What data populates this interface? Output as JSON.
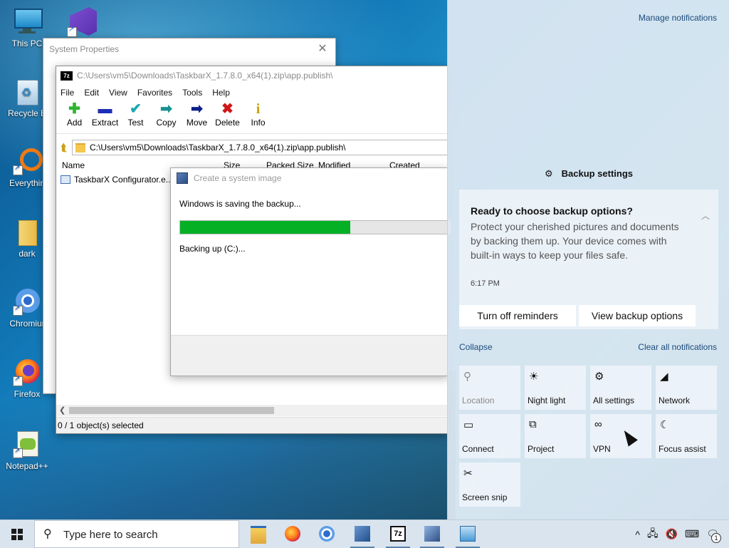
{
  "desktop": {
    "icons": [
      {
        "label": "This PC",
        "icon": "this-pc-icon"
      },
      {
        "label": "Recycle B",
        "icon": "recycle-bin-icon"
      },
      {
        "label": "Everythin",
        "icon": "everything-icon"
      },
      {
        "label": "dark",
        "icon": "folder-icon"
      },
      {
        "label": "Chromiur",
        "icon": "chromium-icon"
      },
      {
        "label": "Firefox",
        "icon": "firefox-icon"
      },
      {
        "label": "Notepad++",
        "icon": "notepadpp-icon"
      }
    ]
  },
  "system_properties": {
    "title": "System Properties",
    "close": "✕"
  },
  "sevenzip": {
    "title": "C:\\Users\\vm5\\Downloads\\TaskbarX_1.7.8.0_x64(1).zip\\app.publish\\",
    "logo": "7z",
    "menu": [
      "File",
      "Edit",
      "View",
      "Favorites",
      "Tools",
      "Help"
    ],
    "toolbar": [
      {
        "label": "Add",
        "icon": "add-icon",
        "glyph": "✚",
        "color": "#2db52d"
      },
      {
        "label": "Extract",
        "icon": "extract-icon",
        "glyph": "▬",
        "color": "#1d2db5"
      },
      {
        "label": "Test",
        "icon": "test-icon",
        "glyph": "✔",
        "color": "#1aa8b0"
      },
      {
        "label": "Copy",
        "icon": "copy-icon",
        "glyph": "➡",
        "color": "#1a9090"
      },
      {
        "label": "Move",
        "icon": "move-icon",
        "glyph": "➡",
        "color": "#0e1f8a"
      },
      {
        "label": "Delete",
        "icon": "delete-icon",
        "glyph": "✖",
        "color": "#d01717"
      },
      {
        "label": "Info",
        "icon": "info-icon",
        "glyph": "i",
        "color": "#c9a400"
      }
    ],
    "address": "C:\\Users\\vm5\\Downloads\\TaskbarX_1.7.8.0_x64(1).zip\\app.publish\\",
    "columns": [
      "Name",
      "Size",
      "Packed Size",
      "Modified",
      "Created"
    ],
    "rows": [
      {
        "name": "TaskbarX Configurator.e..."
      }
    ],
    "status": "0 / 1 object(s) selected"
  },
  "backup_dialog": {
    "title": "Create a system image",
    "message": "Windows is saving the backup...",
    "progress": 0.63,
    "status": "Backing up (C:)..."
  },
  "action_center": {
    "manage": "Manage notifications",
    "group_title": "Backup settings",
    "notification": {
      "title": "Ready to choose backup options?",
      "body": "Protect your cherished pictures and documents by backing them up. Your device comes with built-in ways to keep your files safe.",
      "time": "6:17 PM",
      "buttons": [
        "Turn off reminders",
        "View backup options"
      ]
    },
    "collapse": "Collapse",
    "clear_all": "Clear all notifications",
    "tiles": [
      {
        "label": "Location",
        "icon": "location-icon",
        "disabled": true
      },
      {
        "label": "Night light",
        "icon": "night-light-icon"
      },
      {
        "label": "All settings",
        "icon": "settings-gear-icon"
      },
      {
        "label": "Network",
        "icon": "network-icon"
      },
      {
        "label": "Connect",
        "icon": "connect-icon"
      },
      {
        "label": "Project",
        "icon": "project-icon"
      },
      {
        "label": "VPN",
        "icon": "vpn-icon"
      },
      {
        "label": "Focus assist",
        "icon": "focus-assist-icon"
      },
      {
        "label": "Screen snip",
        "icon": "screen-snip-icon"
      }
    ]
  },
  "taskbar": {
    "search_placeholder": "Type here to search",
    "notification_count": "1"
  }
}
